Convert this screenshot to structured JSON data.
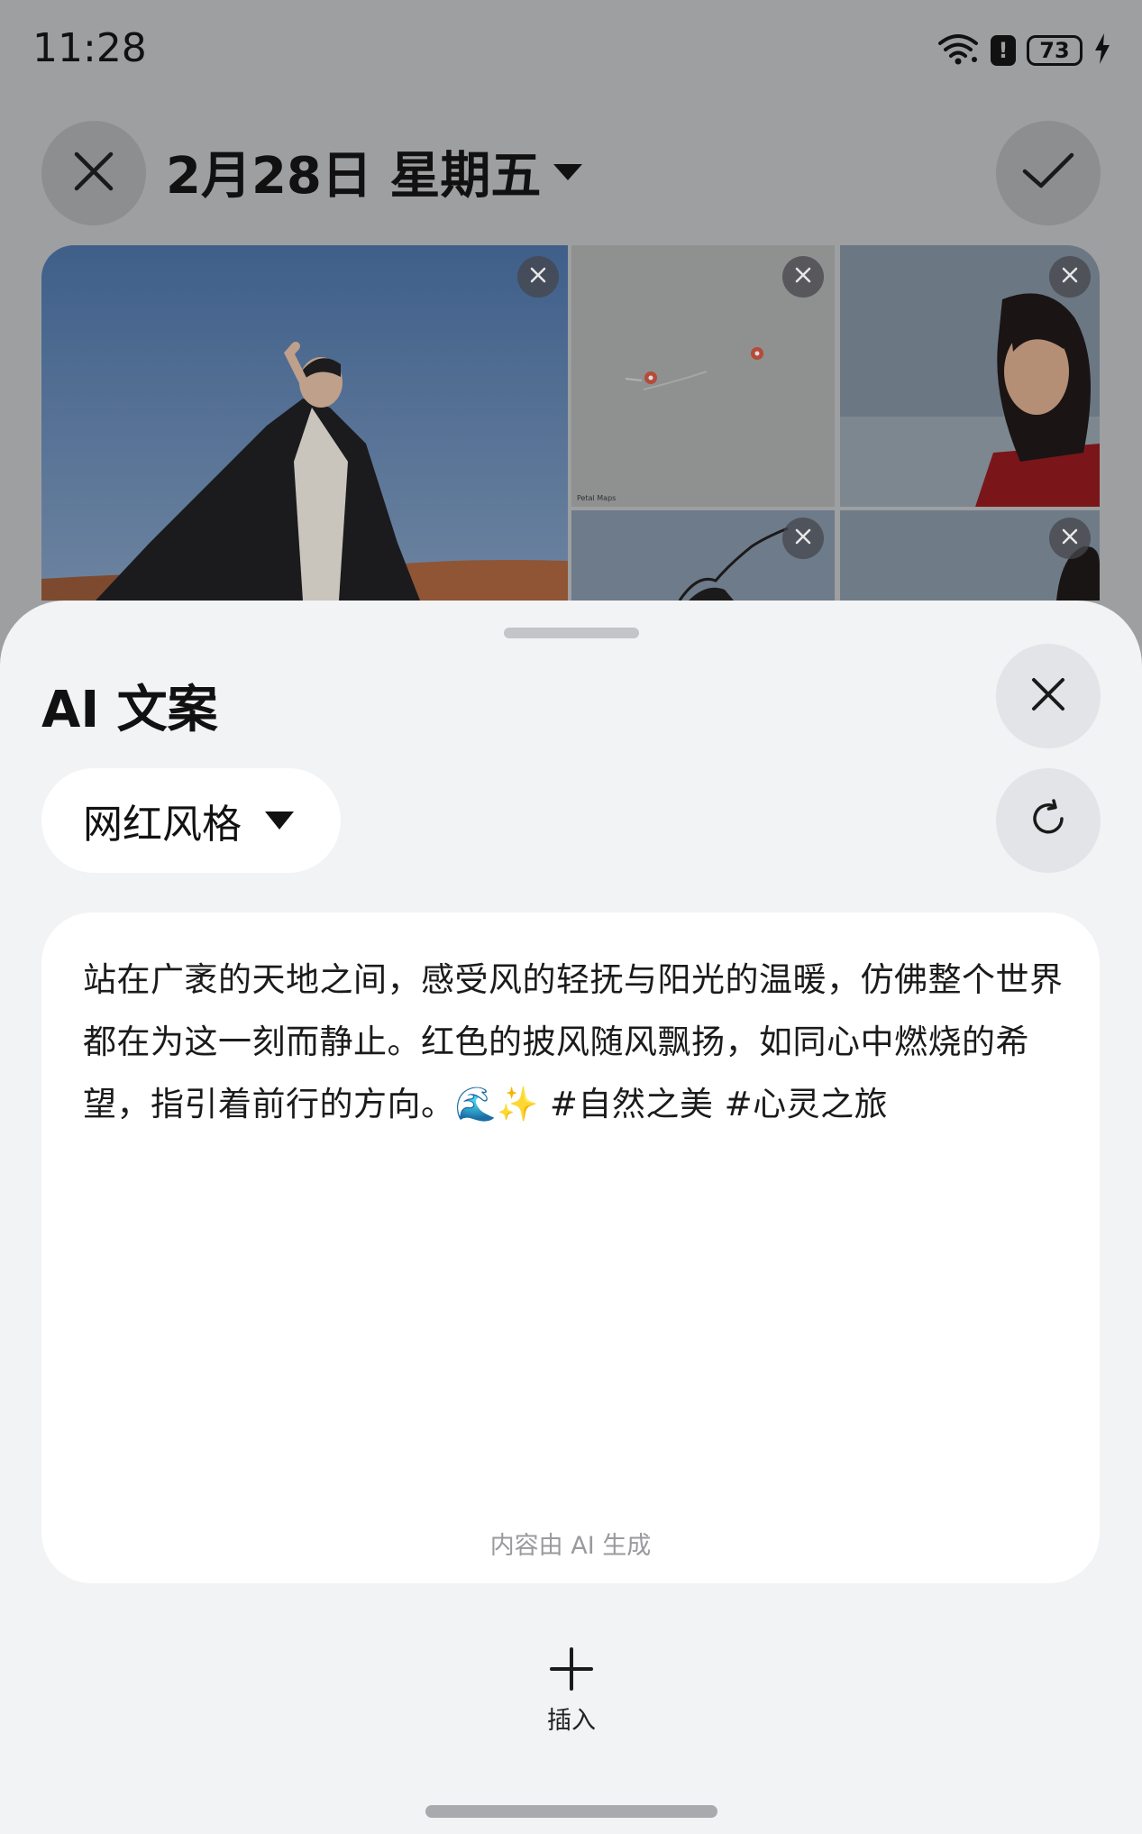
{
  "status_bar": {
    "time": "11:28",
    "battery_level": "73",
    "alert_symbol": "!"
  },
  "header": {
    "date_title": "2月28日 星期五",
    "close_icon": "close-icon",
    "confirm_icon": "check-icon"
  },
  "photos": [
    {
      "subject": "man-in-black-coat-desert"
    },
    {
      "subject": "map"
    },
    {
      "subject": "woman-red-coat-portrait"
    },
    {
      "subject": "woman-wind-hair"
    },
    {
      "subject": "woman-curly-hair"
    }
  ],
  "map_attribution": "Petal Maps",
  "ai_sheet": {
    "title": "AI 文案",
    "style_selected": "网红风格",
    "generated_text": "站在广袤的天地之间，感受风的轻抚与阳光的温暖，仿佛整个世界都在为这一刻而静止。红色的披风随风飘扬，如同心中燃烧的希望，指引着前行的方向。🌊✨ #自然之美 #心灵之旅",
    "ai_note": "内容由 AI 生成",
    "insert_label": "插入"
  },
  "colors": {
    "dim_background": "#9e9fa1",
    "sheet_background": "#f2f3f5",
    "card_background": "#ffffff"
  }
}
